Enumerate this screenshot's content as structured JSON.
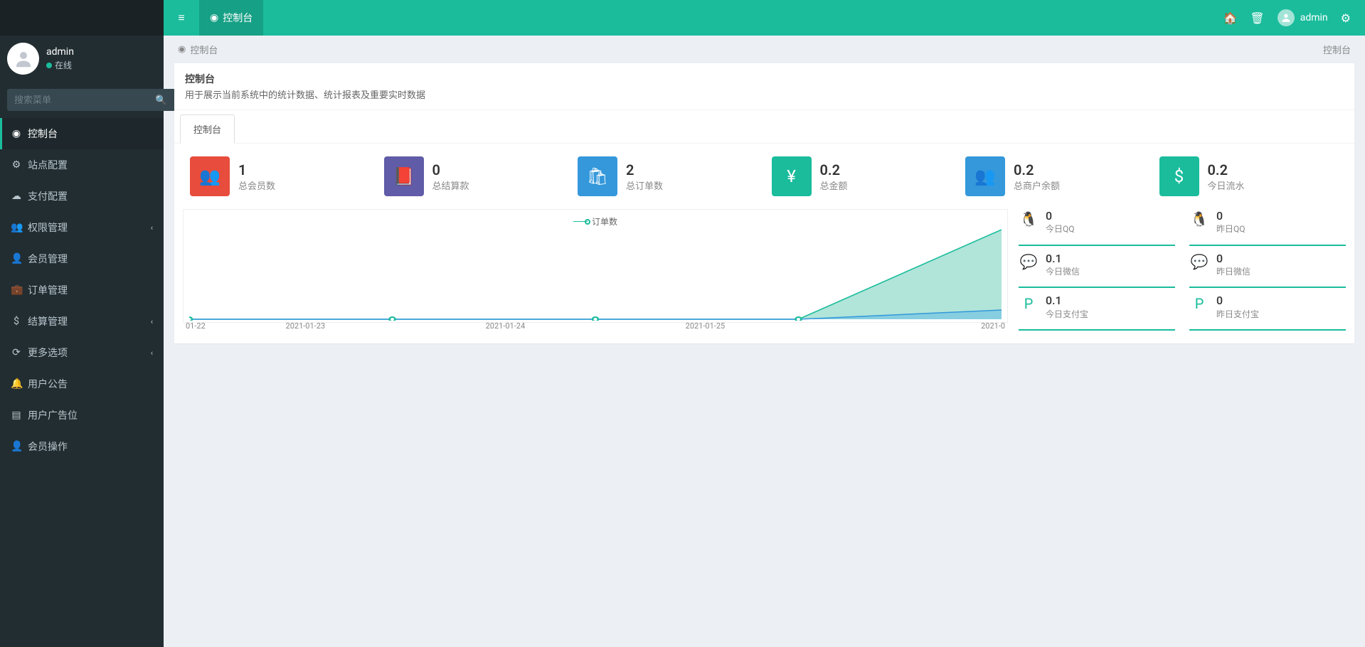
{
  "header": {
    "logo": "",
    "tab_label": "控制台",
    "username": "admin"
  },
  "sidebar": {
    "user_name": "admin",
    "user_status": "在线",
    "search_placeholder": "搜索菜单",
    "items": [
      {
        "icon": "dashboard",
        "label": "控制台",
        "active": true,
        "chevron": false
      },
      {
        "icon": "gear",
        "label": "站点配置",
        "active": false,
        "chevron": false
      },
      {
        "icon": "cloud",
        "label": "支付配置",
        "active": false,
        "chevron": false
      },
      {
        "icon": "users",
        "label": "权限管理",
        "active": false,
        "chevron": true
      },
      {
        "icon": "user",
        "label": "会员管理",
        "active": false,
        "chevron": false
      },
      {
        "icon": "briefcase",
        "label": "订单管理",
        "active": false,
        "chevron": false
      },
      {
        "icon": "dollar",
        "label": "结算管理",
        "active": false,
        "chevron": true
      },
      {
        "icon": "refresh",
        "label": "更多选项",
        "active": false,
        "chevron": true
      },
      {
        "icon": "bell",
        "label": "用户公告",
        "active": false,
        "chevron": false
      },
      {
        "icon": "doc",
        "label": "用户广告位",
        "active": false,
        "chevron": false
      },
      {
        "icon": "user",
        "label": "会员操作",
        "active": false,
        "chevron": false
      }
    ]
  },
  "breadcrumb": {
    "left": "控制台",
    "right": "控制台"
  },
  "panel": {
    "title": "控制台",
    "subtitle": "用于展示当前系统中的统计数据、统计报表及重要实时数据",
    "tab": "控制台"
  },
  "stats": [
    {
      "icon": "users",
      "color": "bg-red",
      "value": "1",
      "label": "总会员数"
    },
    {
      "icon": "book",
      "color": "bg-purple",
      "value": "0",
      "label": "总结算款"
    },
    {
      "icon": "bag",
      "color": "bg-blue",
      "value": "2",
      "label": "总订单数"
    },
    {
      "icon": "yen",
      "color": "bg-green",
      "value": "0.2",
      "label": "总金额"
    },
    {
      "icon": "users",
      "color": "bg-teal",
      "value": "0.2",
      "label": "总商户余额"
    },
    {
      "icon": "dollar",
      "color": "bg-green2",
      "value": "0.2",
      "label": "今日流水"
    }
  ],
  "mini_stats": [
    {
      "icon": "qq",
      "value": "0",
      "label": "今日QQ"
    },
    {
      "icon": "qq",
      "value": "0",
      "label": "昨日QQ"
    },
    {
      "icon": "wechat",
      "value": "0.1",
      "label": "今日微信"
    },
    {
      "icon": "wechat",
      "value": "0",
      "label": "昨日微信"
    },
    {
      "icon": "paypal",
      "value": "0.1",
      "label": "今日支付宝"
    },
    {
      "icon": "paypal",
      "value": "0",
      "label": "昨日支付宝"
    }
  ],
  "chart_data": {
    "type": "area",
    "title": "",
    "legend": "订单数",
    "x": [
      "01-22",
      "2021-01-23",
      "2021-01-24",
      "2021-01-25",
      "2021-0"
    ],
    "series": [
      {
        "name": "订单数",
        "values": [
          0,
          0,
          0,
          0,
          2
        ],
        "color": "#7dd3c0"
      },
      {
        "name": "",
        "values": [
          0,
          0,
          0,
          0,
          0.2
        ],
        "color": "#5bb8e8"
      }
    ],
    "ylim": [
      0,
      2
    ]
  }
}
